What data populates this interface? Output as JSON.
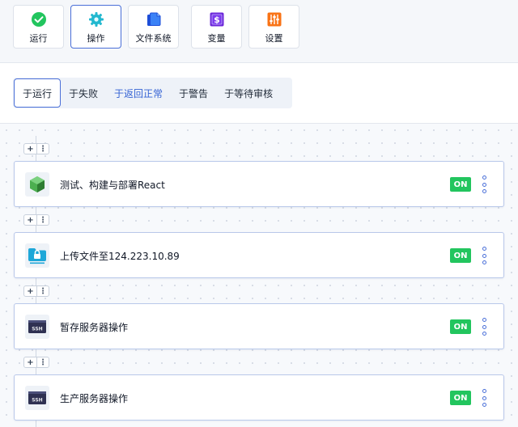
{
  "toolbar": {
    "items": [
      {
        "label": "运行",
        "icon": "check-circle-icon"
      },
      {
        "label": "操作",
        "icon": "gear-icon"
      },
      {
        "label": "文件系统",
        "icon": "file-copy-icon"
      },
      {
        "label": "变量",
        "icon": "dollar-variable-icon"
      },
      {
        "label": "设置",
        "icon": "sliders-icon"
      }
    ],
    "active_index": 1
  },
  "tabs": {
    "items": [
      {
        "label": "于运行"
      },
      {
        "label": "于失败"
      },
      {
        "label": "于返回正常"
      },
      {
        "label": "于警告"
      },
      {
        "label": "于等待审核"
      }
    ],
    "selected_index": 0
  },
  "pipeline": {
    "actions": [
      {
        "title": "测试、构建与部署React",
        "icon": "green-cube-icon",
        "status": "ON"
      },
      {
        "title": "上传文件至124.223.10.89",
        "icon": "sftp-upload-icon",
        "status": "ON"
      },
      {
        "title": "暂存服务器操作",
        "icon": "ssh-terminal-icon",
        "status": "ON"
      },
      {
        "title": "生产服务器操作",
        "icon": "ssh-terminal-icon",
        "status": "ON"
      }
    ],
    "add_button": "+",
    "menu_button": "⋮",
    "ssh_text": "SSH"
  },
  "colors": {
    "accent": "#4a6fd8",
    "on_green": "#22c55e",
    "card_border": "#b9c8ea"
  }
}
